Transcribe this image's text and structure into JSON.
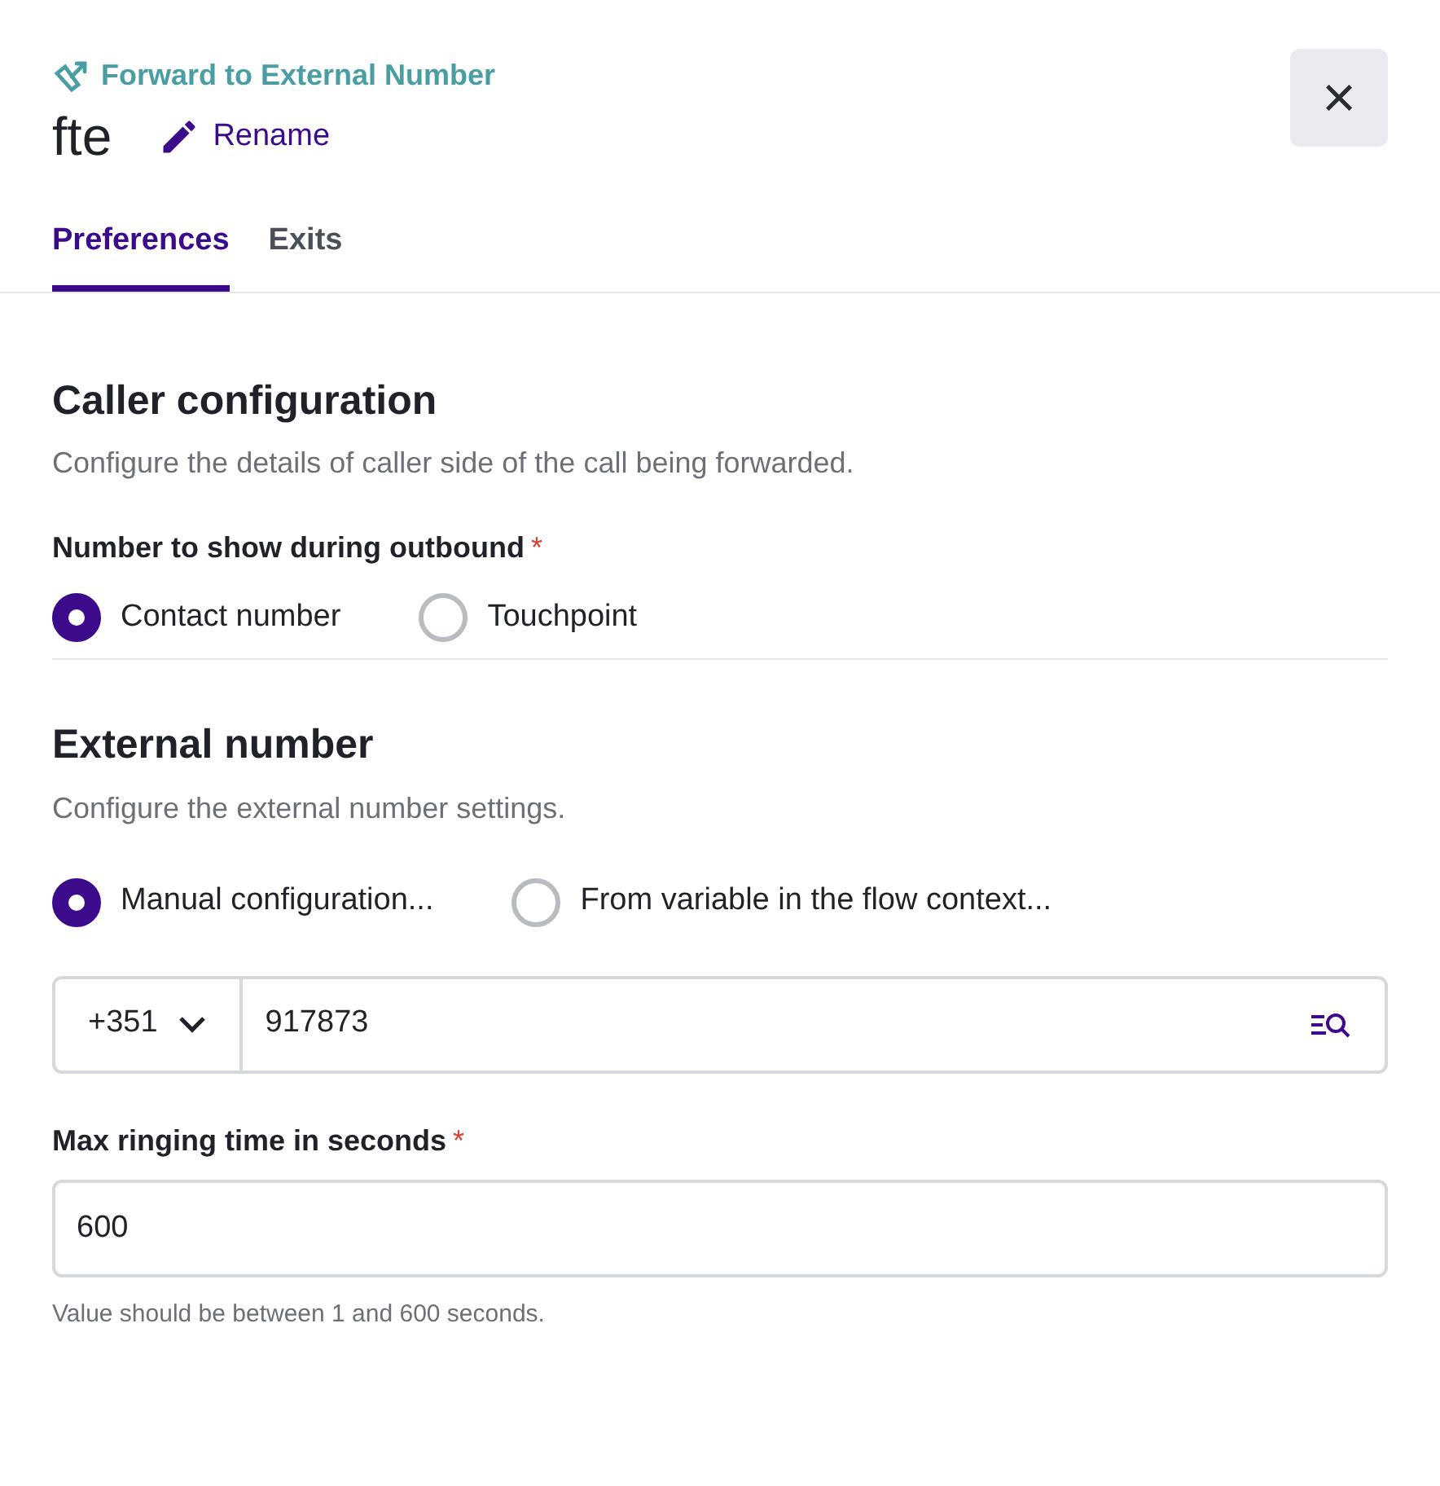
{
  "header": {
    "type_label": "Forward to External Number",
    "title": "fte",
    "rename": "Rename",
    "close": "×"
  },
  "tabs": [
    {
      "label": "Preferences",
      "selected": true
    },
    {
      "label": "Exits",
      "selected": false
    }
  ],
  "caller": {
    "heading": "Caller configuration",
    "description": "Configure the details of caller side of the call being forwarded.",
    "field_label": "Number to show during outbound",
    "required_mark": "*",
    "options": [
      {
        "label": "Contact number",
        "selected": true
      },
      {
        "label": "Touchpoint",
        "selected": false
      }
    ]
  },
  "external": {
    "heading": "External number",
    "description": "Configure the external number settings.",
    "options": [
      {
        "label": "Manual configuration...",
        "selected": true
      },
      {
        "label": "From variable in the flow context...",
        "selected": false
      }
    ],
    "country_code": "+351",
    "number": "917873",
    "ringing_label": "Max ringing time in seconds",
    "ringing_required_mark": "*",
    "ringing_value": "600",
    "hint": "Value should be between 1 and 600 seconds."
  }
}
